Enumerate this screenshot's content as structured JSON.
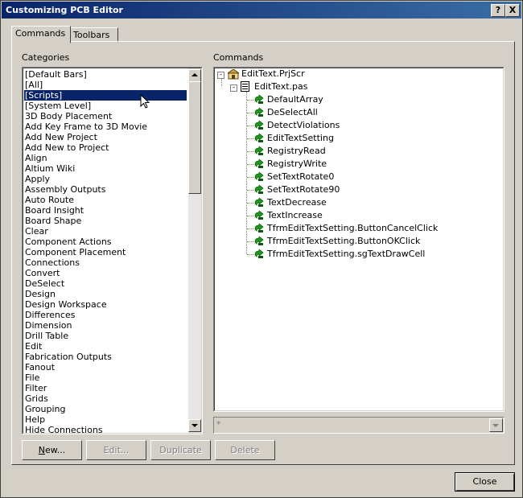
{
  "window": {
    "title": "Customizing PCB Editor",
    "help_glyph": "?",
    "close_glyph": "X"
  },
  "tabs": [
    {
      "label": "Commands",
      "active": true
    },
    {
      "label": "Toolbars",
      "active": false
    }
  ],
  "categories": {
    "heading": "Categories",
    "selected_index": 2,
    "items": [
      "[Default Bars]",
      "[All]",
      "[Scripts]",
      "[System Level]",
      "3D Body Placement",
      "Add Key Frame to 3D Movie",
      "Add New Project",
      "Add New to Project",
      "Align",
      "Altium Wiki",
      "Apply",
      "Assembly Outputs",
      "Auto Route",
      "Board Insight",
      "Board Shape",
      "Clear",
      "Component Actions",
      "Component Placement",
      "Connections",
      "Convert",
      "DeSelect",
      "Design",
      "Design Workspace",
      "Differences",
      "Dimension",
      "Drill Table",
      "Edit",
      "Fabrication Outputs",
      "Fanout",
      "File",
      "Filter",
      "Grids",
      "Grouping",
      "Help",
      "Hide Connections"
    ]
  },
  "commands": {
    "heading": "Commands",
    "project": {
      "label": "EditText.PrjScr",
      "icon": "project-icon",
      "expander": "-"
    },
    "file": {
      "label": "EditText.pas",
      "icon": "document-icon",
      "expander": "-"
    },
    "procedures": [
      "DefaultArray",
      "DeSelectAll",
      "DetectViolations",
      "EditTextSetting",
      "RegistryRead",
      "RegistryWrite",
      "SetTextRotate0",
      "SetTextRotate90",
      "TextDecrease",
      "TextIncrease",
      "TfrmEditTextSetting.ButtonCancelClick",
      "TfrmEditTextSetting.ButtonOKClick",
      "TfrmEditTextSetting.sgTextDrawCell"
    ],
    "procedure_icon": "script-procedure-icon"
  },
  "filter_combo": {
    "value": "*"
  },
  "buttons": {
    "new": "New...",
    "edit": "Edit...",
    "duplicate": "Duplicate",
    "delete": "Delete",
    "close": "Close"
  },
  "colors": {
    "selection": "#0a246a",
    "title_gradient_start": "#0a246a",
    "title_gradient_end": "#3a6ea5",
    "procedure_icon_green": "#1a9a1a"
  }
}
